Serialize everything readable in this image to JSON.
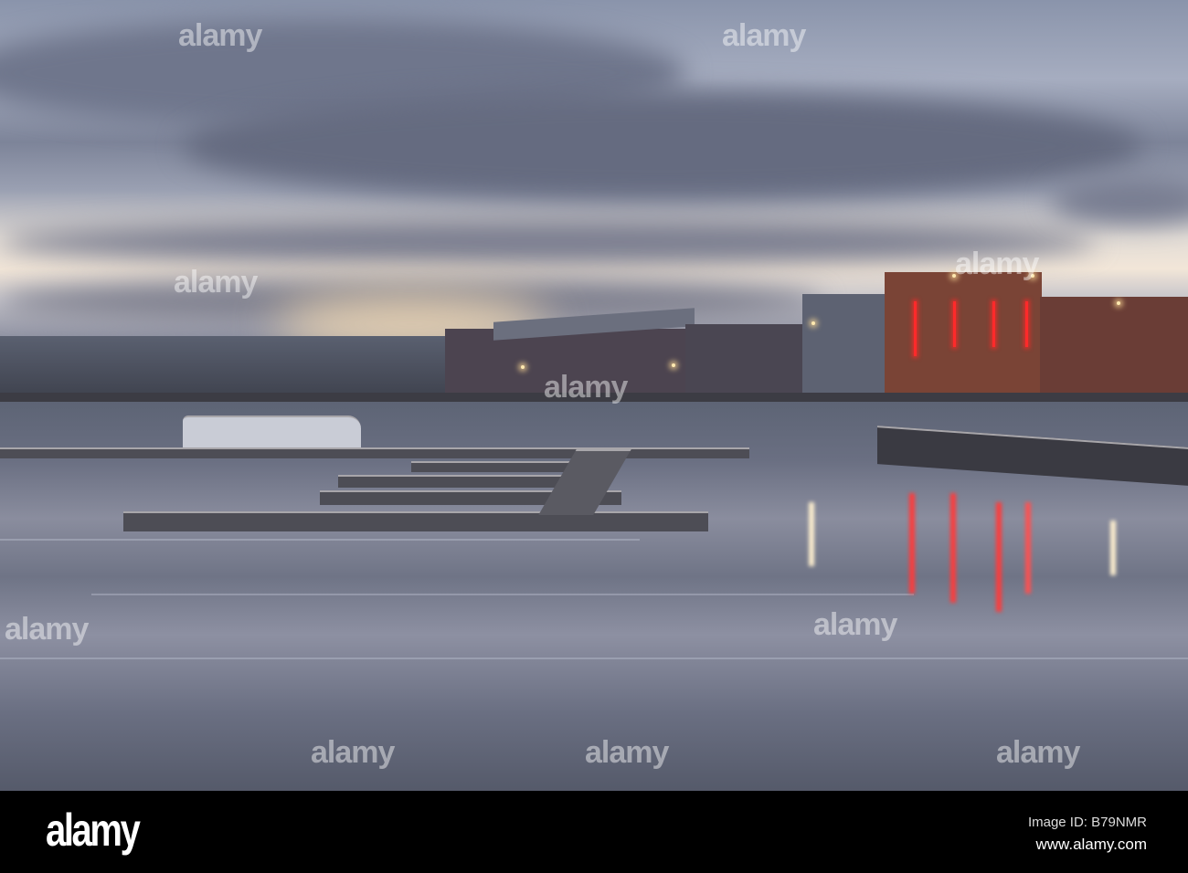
{
  "photo": {
    "subject": "marina waterfront at dusk"
  },
  "watermarks": [
    "alamy",
    "alamy",
    "alamy",
    "alamy",
    "alamy",
    "alamy",
    "alamy",
    "alamy",
    "alamy",
    "alamy"
  ],
  "footer": {
    "logo": "alamy",
    "image_id": "Image ID: B79NMR",
    "website": "www.alamy.com"
  }
}
